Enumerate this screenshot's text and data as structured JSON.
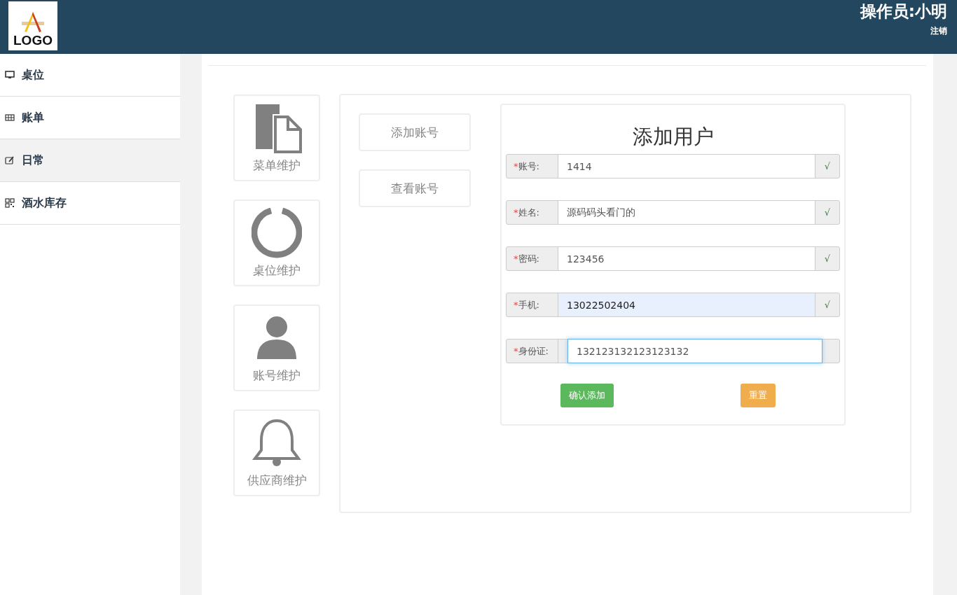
{
  "header": {
    "logo_text": "LOGO",
    "operator": "操作员:小明",
    "logout": "注销"
  },
  "sidebar": {
    "items": [
      {
        "label": "桌位",
        "kind": "monitor",
        "selected": false
      },
      {
        "label": "账单",
        "kind": "table",
        "selected": false
      },
      {
        "label": "日常",
        "kind": "edit",
        "selected": true
      },
      {
        "label": "酒水库存",
        "kind": "grid",
        "selected": false
      }
    ]
  },
  "tiles": [
    {
      "label": "菜单维护",
      "kind": "file"
    },
    {
      "label": "桌位维护",
      "kind": "ring"
    },
    {
      "label": "账号维护",
      "kind": "user"
    },
    {
      "label": "供应商维护",
      "kind": "bell"
    }
  ],
  "sub_buttons": [
    "添加账号",
    "查看账号"
  ],
  "form": {
    "title": "添加用户",
    "fields": [
      {
        "mark": "*",
        "label": "账号:",
        "value": "1414",
        "check": "√",
        "autofilled": false,
        "focused": false
      },
      {
        "mark": "*",
        "label": "姓名:",
        "value": "源码码头看门的",
        "check": "√",
        "autofilled": false,
        "focused": false
      },
      {
        "mark": "*",
        "label": "密码:",
        "value": "123456",
        "check": "√",
        "autofilled": false,
        "focused": false
      },
      {
        "mark": "*",
        "label": "手机:",
        "value": "13022502404",
        "check": "√",
        "autofilled": true,
        "focused": false
      },
      {
        "mark": "*",
        "label": "身份证:",
        "value": "132123132123123132",
        "autofilled": false,
        "focused": true
      }
    ],
    "buttons": [
      {
        "label": "确认添加",
        "kind": "success"
      },
      {
        "label": "重置",
        "kind": "warning"
      }
    ]
  }
}
